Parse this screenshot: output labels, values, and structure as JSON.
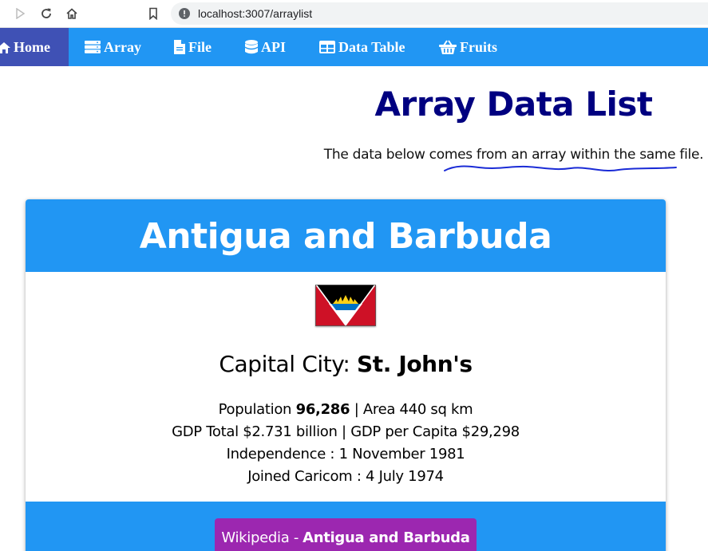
{
  "browser": {
    "url": "localhost:3007/arraylist"
  },
  "nav": {
    "items": [
      {
        "label": "Home",
        "icon": "home-icon"
      },
      {
        "label": "Array",
        "icon": "server-icon"
      },
      {
        "label": "File",
        "icon": "file-icon"
      },
      {
        "label": "API",
        "icon": "database-icon"
      },
      {
        "label": "Data Table",
        "icon": "table-icon"
      },
      {
        "label": "Fruits",
        "icon": "basket-icon"
      }
    ]
  },
  "page": {
    "title": "Array Data List",
    "subtitle": "The data below comes from an array within the same file."
  },
  "country": {
    "name": "Antigua and Barbuda",
    "capital_label": "Capital City:",
    "capital": "St. John's",
    "population_label": "Population",
    "population": "96,286",
    "area": "| Area 440 sq km",
    "gdp": "GDP Total $2.731 billion | GDP per Capita $29,298",
    "independence": "Independence : 1 November 1981",
    "caricom": "Joined Caricom : 4 July 1974",
    "wiki_prefix": "Wikipedia -",
    "wiki_name": "Antigua and Barbuda"
  },
  "colors": {
    "nav_bg": "#2196f3",
    "nav_active": "#3f51b5",
    "title": "#000080",
    "wiki_button": "#9c27b0"
  }
}
